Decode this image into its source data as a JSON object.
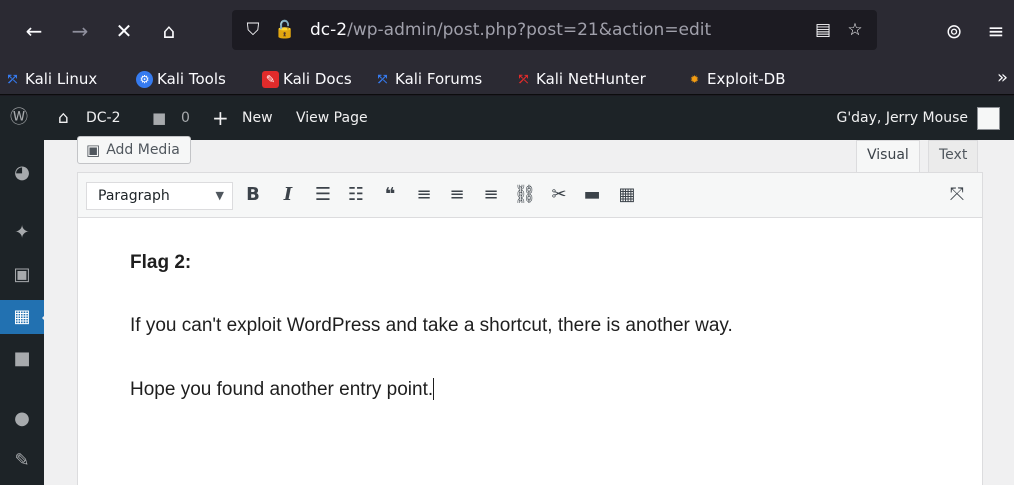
{
  "browser": {
    "url_host": "dc-2",
    "url_path": "/wp-admin/post.php?post=21&action=edit",
    "icons": [
      "back-icon",
      "forward-icon",
      "stop-icon",
      "home-icon",
      "shield-icon",
      "lock-broken-icon",
      "reader-icon",
      "star-icon",
      "pocket-icon",
      "menu-icon"
    ]
  },
  "bookmarks": {
    "items": [
      {
        "label": "Kali Linux",
        "icon": "kali-dragon-icon",
        "color": "#367bf0"
      },
      {
        "label": "Kali Tools",
        "icon": "kali-tools-icon",
        "color": "#e53e3e"
      },
      {
        "label": "Kali Docs",
        "icon": "kali-docs-icon",
        "color": "#e02b2b"
      },
      {
        "label": "Kali Forums",
        "icon": "kali-forums-icon",
        "color": "#367bf0"
      },
      {
        "label": "Kali NetHunter",
        "icon": "nethunter-icon",
        "color": "#e02b2b"
      },
      {
        "label": "Exploit-DB",
        "icon": "exploitdb-icon",
        "color": "#f39c12"
      }
    ],
    "more": "»"
  },
  "adminbar": {
    "site_name": "DC-2",
    "comments_count": "0",
    "new_label": "New",
    "view_page": "View Page",
    "greeting": "G'day, Jerry Mouse"
  },
  "editor": {
    "add_media": "Add Media",
    "tab_visual": "Visual",
    "tab_text": "Text",
    "format_select": "Paragraph",
    "content": {
      "heading": "Flag 2:",
      "paragraph1": "If you can't exploit WordPress and take a shortcut, there is another way.",
      "paragraph2": "Hope you found another entry point."
    }
  },
  "colors": {
    "admin_bar": "#1d2327",
    "accent": "#2271b1",
    "browser_chrome": "#2b2a33"
  }
}
